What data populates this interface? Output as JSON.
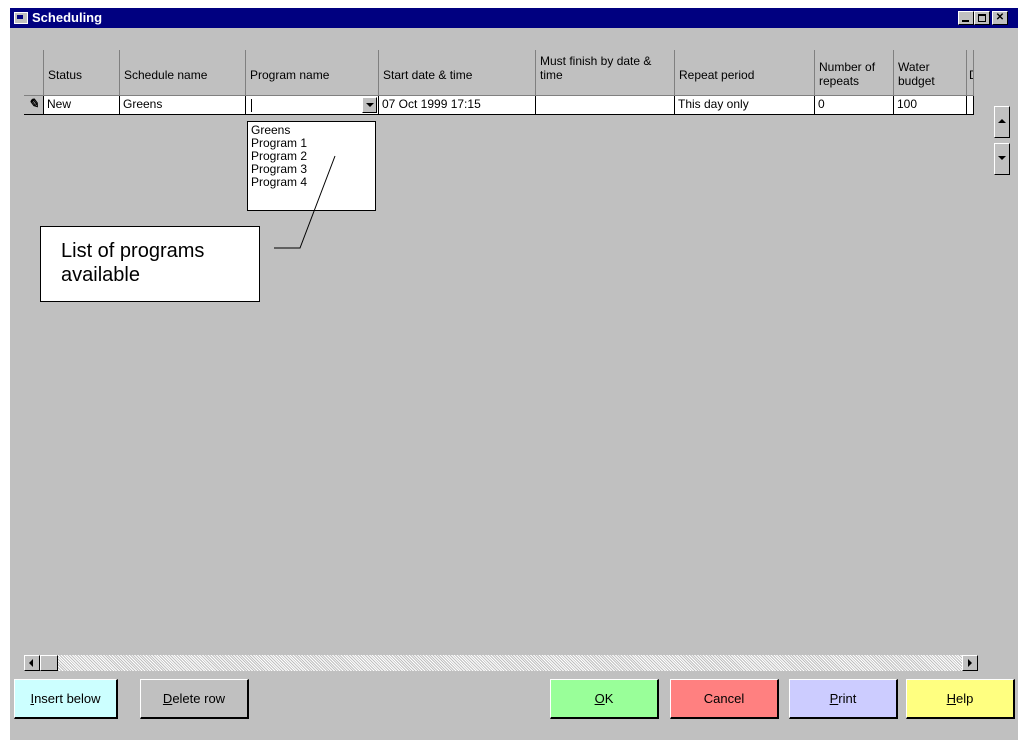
{
  "window": {
    "title": "Scheduling"
  },
  "grid": {
    "columns": [
      "Status",
      "Schedule name",
      "Program name",
      "Start date & time",
      "Must finish by date & time",
      "Repeat period",
      "Number of repeats",
      "Water budget",
      "D"
    ],
    "row": {
      "selector_glyph": "✎",
      "status": "New",
      "schedule_name": "Greens",
      "program_name": "",
      "start": "07 Oct 1999 17:15",
      "must_finish": "",
      "repeat_period": "This day only",
      "number_of_repeats": "0",
      "water_budget": "100",
      "d": ""
    }
  },
  "program_list": [
    "Greens",
    "Program 1",
    "Program 2",
    "Program 3",
    "Program 4"
  ],
  "annotation": {
    "text_line1": "List of programs",
    "text_line2": "available"
  },
  "buttons": {
    "insert_below": {
      "mnemonic": "I",
      "rest": "nsert below",
      "color": "#ccffff"
    },
    "delete_row": {
      "mnemonic": "D",
      "rest": "elete row",
      "color": "#c0c0c0"
    },
    "ok": {
      "mnemonic": "O",
      "rest": "K",
      "color": "#99ff99"
    },
    "cancel": {
      "label": "Cancel",
      "color": "#ff8080"
    },
    "print": {
      "mnemonic": "P",
      "rest": "rint",
      "color": "#ccccff"
    },
    "help": {
      "mnemonic": "H",
      "rest": "elp",
      "color": "#ffff80"
    }
  },
  "icons": {
    "window": "app-window-icon",
    "minimize": "minimize-icon",
    "maximize": "maximize-icon",
    "close": "close-icon"
  }
}
